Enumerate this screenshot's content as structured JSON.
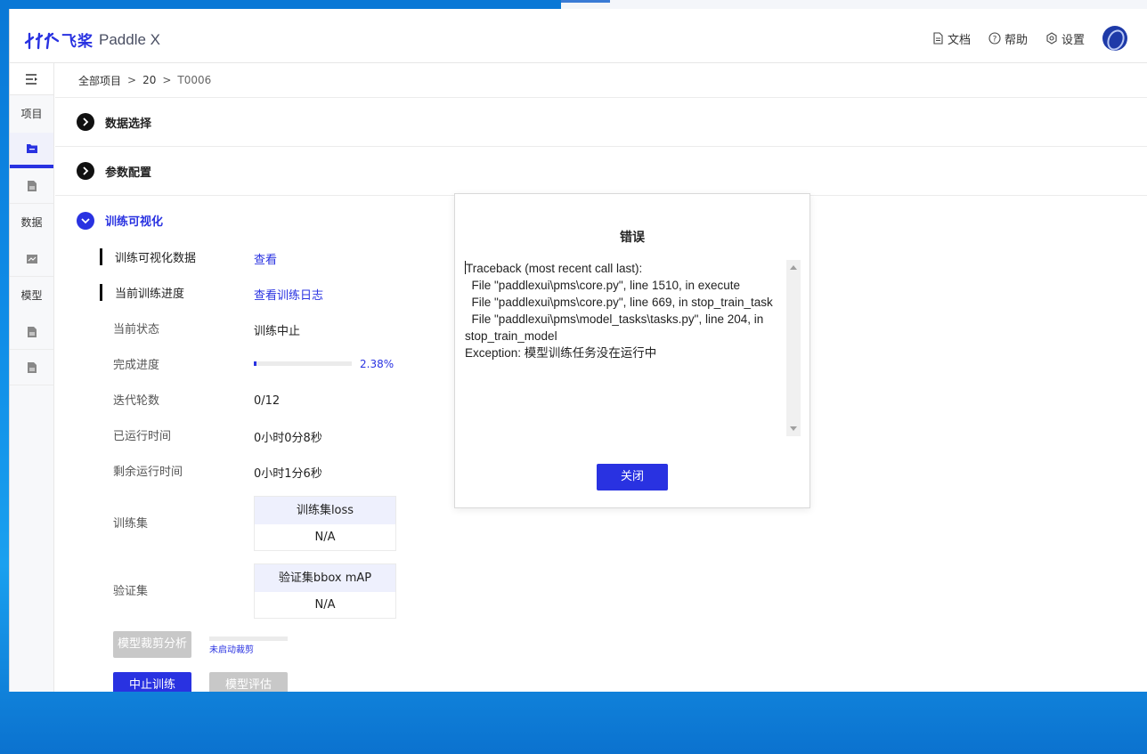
{
  "app": {
    "logo_cn": "飞桨",
    "logo_en": "Paddle X"
  },
  "header": {
    "docs": "文档",
    "help": "帮助",
    "settings": "设置"
  },
  "sidebar": {
    "project_label": "项目",
    "data_label": "数据",
    "model_label": "模型"
  },
  "breadcrumb": {
    "items": [
      "全部项目",
      "20",
      "T0006"
    ],
    "separator": ">"
  },
  "sections": {
    "data_select": "数据选择",
    "param_config": "参数配置",
    "train_viz": "训练可视化"
  },
  "train_viz": {
    "viz_data_label": "训练可视化数据",
    "viz_data_link": "查看",
    "progress_label": "当前训练进度",
    "progress_link": "查看训练日志",
    "status_label": "当前状态",
    "status_value": "训练中止",
    "completion_label": "完成进度",
    "completion_fraction": 0.0238,
    "completion_pct": "2.38%",
    "epochs_label": "迭代轮数",
    "epochs_value": "0/12",
    "elapsed_label": "已运行时间",
    "elapsed_value": "0小时0分8秒",
    "remaining_label": "剩余运行时间",
    "remaining_value": "0小时1分6秒",
    "train_set_label": "训练集",
    "train_loss_head": "训练集loss",
    "train_loss_value": "N/A",
    "val_set_label": "验证集",
    "val_map_head": "验证集bbox mAP",
    "val_map_value": "N/A",
    "prune_button": "模型裁剪分析",
    "prune_status": "未启动裁剪",
    "stop_button": "中止训练",
    "eval_button": "模型评估"
  },
  "modal": {
    "title": "错误",
    "traceback": [
      "Traceback (most recent call last):",
      "  File \"paddlexui\\pms\\core.py\", line 1510, in execute",
      "  File \"paddlexui\\pms\\core.py\", line 669, in stop_train_task",
      "  File \"paddlexui\\pms\\model_tasks\\tasks.py\", line 204, in",
      "stop_train_model",
      "Exception: 模型训练任务没在运行中"
    ],
    "close_button": "关闭"
  },
  "colors": {
    "accent": "#2932e1",
    "desktop": "#0f8be6"
  }
}
